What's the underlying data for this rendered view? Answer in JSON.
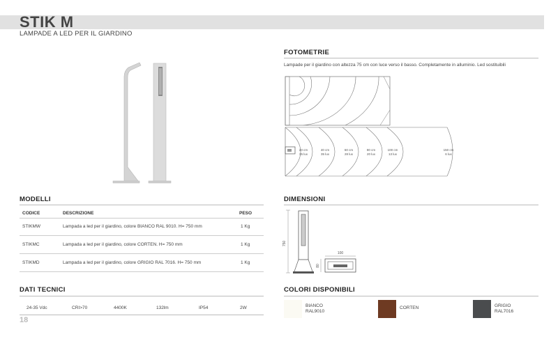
{
  "header": {
    "title": "STIK M",
    "subtitle": "LAMPADE A LED PER IL GIARDINO"
  },
  "photometry": {
    "heading": "FOTOMETRIE",
    "description": "Lampade per il giardino con altezza 75 cm con luce verso il basso. Completamente in alluminio. Led sostituibili",
    "rings": [
      {
        "distance": "20 cm",
        "lux": "35 lux"
      },
      {
        "distance": "40 cm",
        "lux": "35 lux"
      },
      {
        "distance": "60 cm",
        "lux": "28 lux"
      },
      {
        "distance": "80 cm",
        "lux": "20 lux"
      },
      {
        "distance": "100 cm",
        "lux": "13 lux"
      },
      {
        "distance": "150 cm",
        "lux": "6 lux"
      }
    ]
  },
  "models": {
    "heading": "MODELLI",
    "columns": {
      "code": "CODICE",
      "description": "DESCRIZIONE",
      "weight": "PESO"
    },
    "rows": [
      {
        "code": "STIKMW",
        "description": "Lampada a led per il giardino, colore BIANCO RAL 9010. H= 750 mm",
        "weight": "1 Kg"
      },
      {
        "code": "STIKMC",
        "description": "Lampada a led per il giardino, colore CORTEN. H= 750 mm",
        "weight": "1 Kg"
      },
      {
        "code": "STIKMD",
        "description": "Lampada a led per il giardino, colore GRIGIO RAL 7016. H= 750 mm",
        "weight": "1 Kg"
      }
    ]
  },
  "dimensions": {
    "heading": "DIMENSIONI",
    "height": "750",
    "width": "100",
    "depth": "80"
  },
  "tech": {
    "heading": "DATI TECNICI",
    "specs": [
      "24-35 Vdc",
      "CRI>70",
      "4400K",
      "132lm",
      "IP54",
      "2W"
    ]
  },
  "colors": {
    "heading": "COLORI DISPONIBILI",
    "items": [
      {
        "line1": "BIANCO",
        "line2": "RAL9010",
        "hex": "#fbfaf3"
      },
      {
        "line1": "CORTEN",
        "line2": "",
        "hex": "#6e3a22"
      },
      {
        "line1": "GRIGIO",
        "line2": "RAL7016",
        "hex": "#4a4c4e"
      }
    ]
  },
  "page_number": "18"
}
